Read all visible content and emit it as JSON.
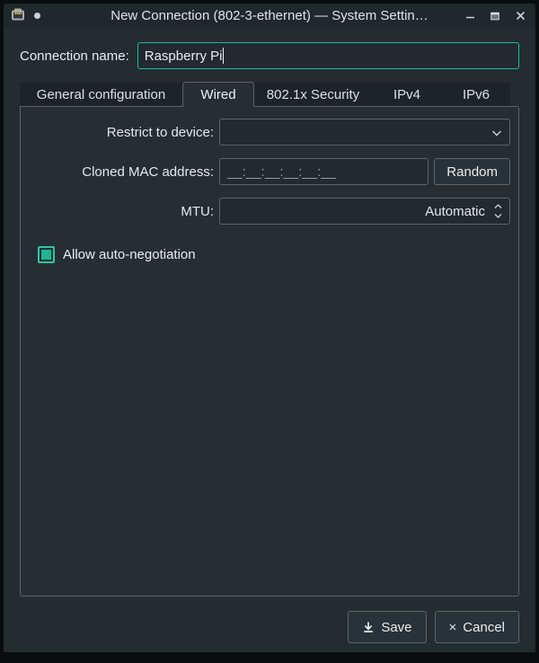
{
  "colors": {
    "accent": "#1abc9c",
    "checkbox_fill": "#1db795"
  },
  "titlebar": {
    "title": "New Connection (802-3-ethernet) — System Settin…",
    "app_icon": "ethernet-port",
    "minimize_glyph": "–",
    "close_glyph": "×"
  },
  "name_row": {
    "label": "Connection name:",
    "value": "Raspberry Pi"
  },
  "tabs": [
    {
      "label": "General configuration",
      "active": false
    },
    {
      "label": "Wired",
      "active": true
    },
    {
      "label": "802.1x Security",
      "active": false
    },
    {
      "label": "IPv4",
      "active": false
    },
    {
      "label": "IPv6",
      "active": false
    }
  ],
  "wired": {
    "restrict": {
      "label": "Restrict to device:",
      "value": ""
    },
    "mac": {
      "label": "Cloned MAC address:",
      "placeholder": "__:__:__:__:__:__",
      "random_button": "Random"
    },
    "mtu": {
      "label": "MTU:",
      "value": "Automatic"
    },
    "autoneg": {
      "label": "Allow auto-negotiation",
      "checked": true
    }
  },
  "footer": {
    "save_label": "Save",
    "cancel_label": "Cancel",
    "cancel_glyph": "×"
  }
}
